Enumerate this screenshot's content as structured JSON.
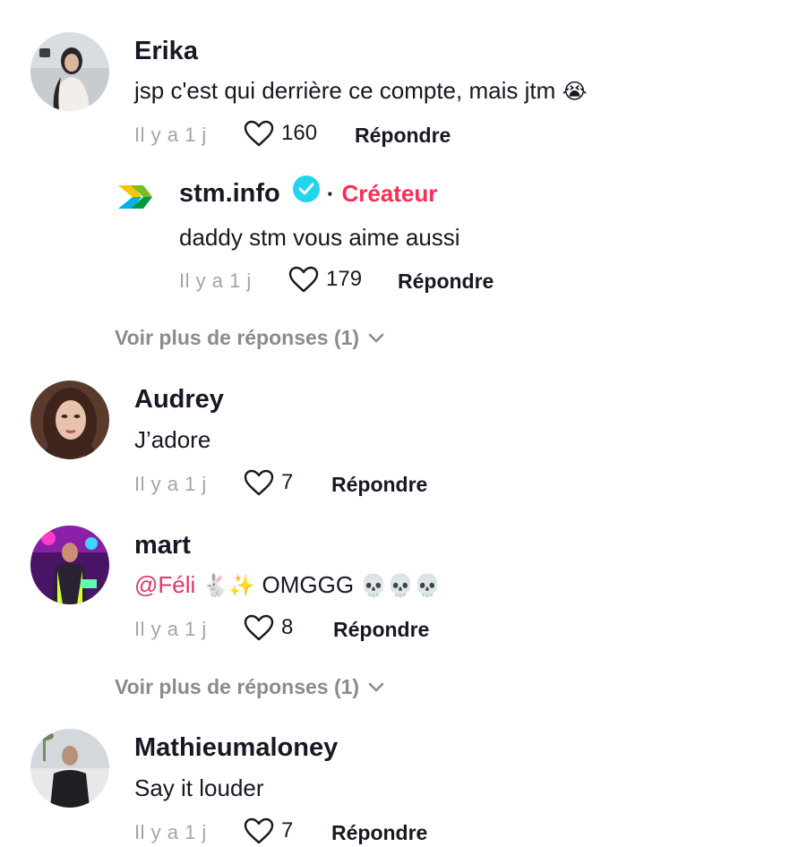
{
  "comments": [
    {
      "name": "Erika",
      "text": "jsp c'est qui derrière ce compte, mais jtm",
      "emoji": "😭",
      "time": "Il y a 1 j",
      "likes": "160",
      "reply_label": "Répondre",
      "replies": [
        {
          "name": "stm.info",
          "badge_separator": "·",
          "creator_label": "Créateur",
          "text": "daddy stm vous aime aussi",
          "time": "Il y a 1 j",
          "likes": "179",
          "reply_label": "Répondre"
        }
      ],
      "more_replies": "Voir plus de réponses (1)"
    },
    {
      "name": "Audrey",
      "text": "J’adore",
      "time": "Il y a 1 j",
      "likes": "7",
      "reply_label": "Répondre"
    },
    {
      "name": "mart",
      "mention": "@Féli",
      "mention_emojis": "🐇✨",
      "text": "OMGGG",
      "emojis": "💀💀💀",
      "time": "Il y a 1 j",
      "likes": "8",
      "reply_label": "Répondre",
      "more_replies": "Voir plus de réponses (1)"
    },
    {
      "name": "Mathieumaloney",
      "text": "Say it louder",
      "time": "Il y a 1 j",
      "likes": "7",
      "reply_label": "Répondre"
    }
  ],
  "colors": {
    "creator": "#fe2c55",
    "mention": "#e3366e",
    "verified": "#20d5ec",
    "muted": "#a3a4a8"
  },
  "icons": [
    "heart-outline-icon",
    "chevron-down-icon",
    "verified-check-icon",
    "stm-logo-icon"
  ]
}
